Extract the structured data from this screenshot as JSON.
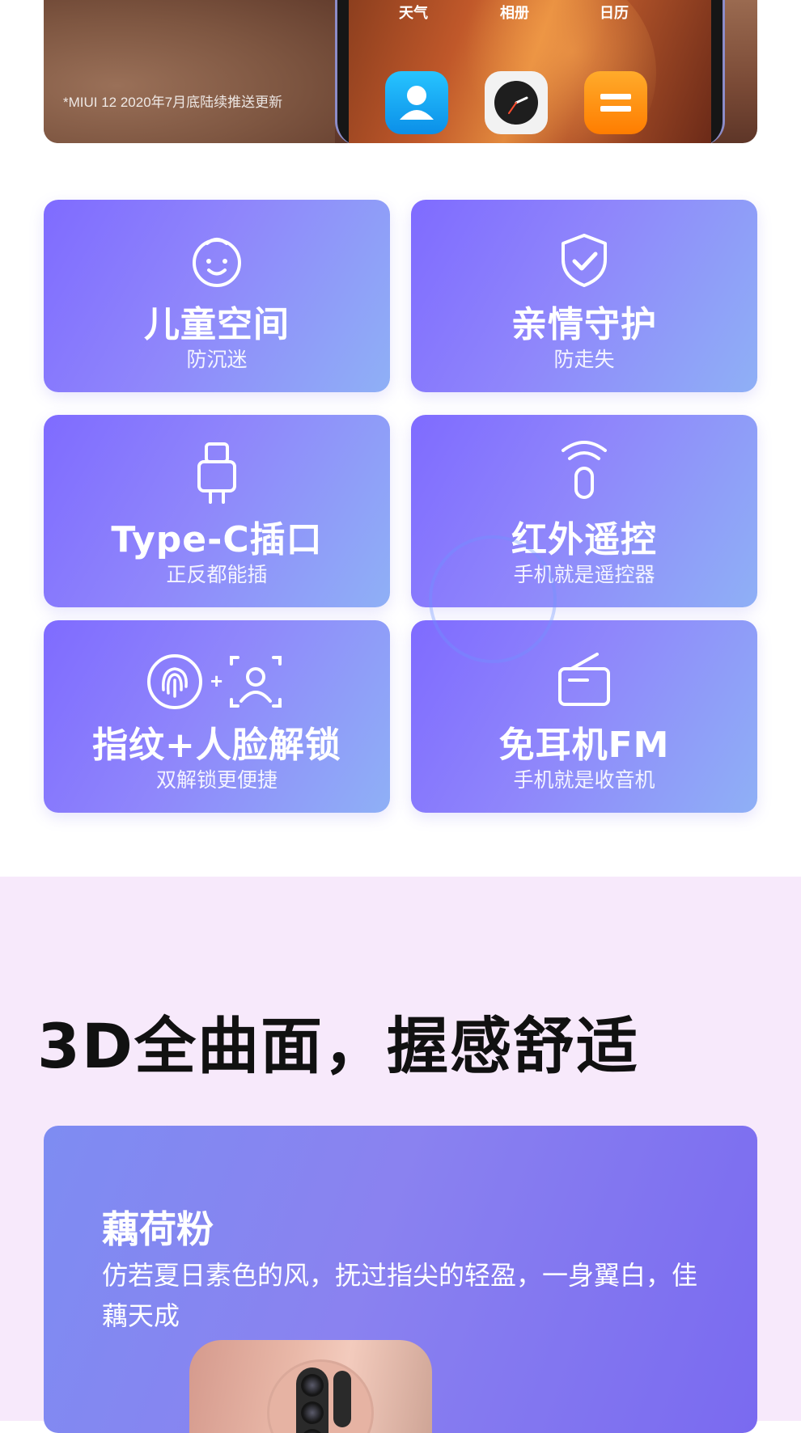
{
  "hero": {
    "note": "*MIUI 12 2020年7月底陆续推送更新",
    "apps": [
      {
        "label": "天气",
        "icon": "weather-label"
      },
      {
        "label": "相册",
        "icon": "gallery-label"
      },
      {
        "label": "日历",
        "icon": "calendar-label"
      }
    ],
    "dock": [
      "contacts-icon",
      "clock-icon",
      "notes-icon"
    ]
  },
  "features": [
    {
      "title": "儿童空间",
      "subtitle": "防沉迷",
      "icon": "child-face-icon"
    },
    {
      "title": "亲情守护",
      "subtitle": "防走失",
      "icon": "shield-check-icon"
    },
    {
      "title": "Type-C插口",
      "subtitle": "正反都能插",
      "icon": "usb-c-plug-icon"
    },
    {
      "title": "红外遥控",
      "subtitle": "手机就是遥控器",
      "icon": "infrared-remote-icon"
    },
    {
      "title": "指纹+人脸解锁",
      "subtitle": "双解锁更便捷",
      "icon": "fingerprint-face-icon",
      "plus": "+"
    },
    {
      "title": "免耳机FM",
      "subtitle": "手机就是收音机",
      "icon": "radio-icon"
    }
  ],
  "section2": {
    "title": "3D全曲面，握感舒适",
    "color_name": "藕荷粉",
    "description": "仿若夏日素色的风，抚过指尖的轻盈，一身翼白，佳藕天成"
  },
  "colors": {
    "card_start": "#7f6bff",
    "card_end": "#8fb0f6",
    "section_bg": "#f7e9fb"
  }
}
